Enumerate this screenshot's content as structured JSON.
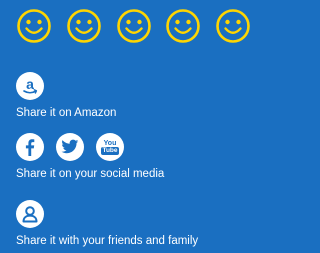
{
  "colors": {
    "background": "#1a6fc1",
    "smiley": "#ffd500",
    "icon_circle": "#ffffff",
    "text": "#ffffff"
  },
  "rating": {
    "icons": [
      "smiley-icon",
      "smiley-icon",
      "smiley-icon",
      "smiley-icon",
      "smiley-icon"
    ]
  },
  "amazon": {
    "icon": "amazon-icon",
    "label": "Share it on Amazon"
  },
  "social": {
    "icons": [
      "facebook-icon",
      "twitter-icon",
      "youtube-icon"
    ],
    "youtube_you": "You",
    "youtube_tube": "Tube",
    "label": "Share it on your social media"
  },
  "friends": {
    "icon": "person-icon",
    "label": "Share it with your friends and family"
  }
}
